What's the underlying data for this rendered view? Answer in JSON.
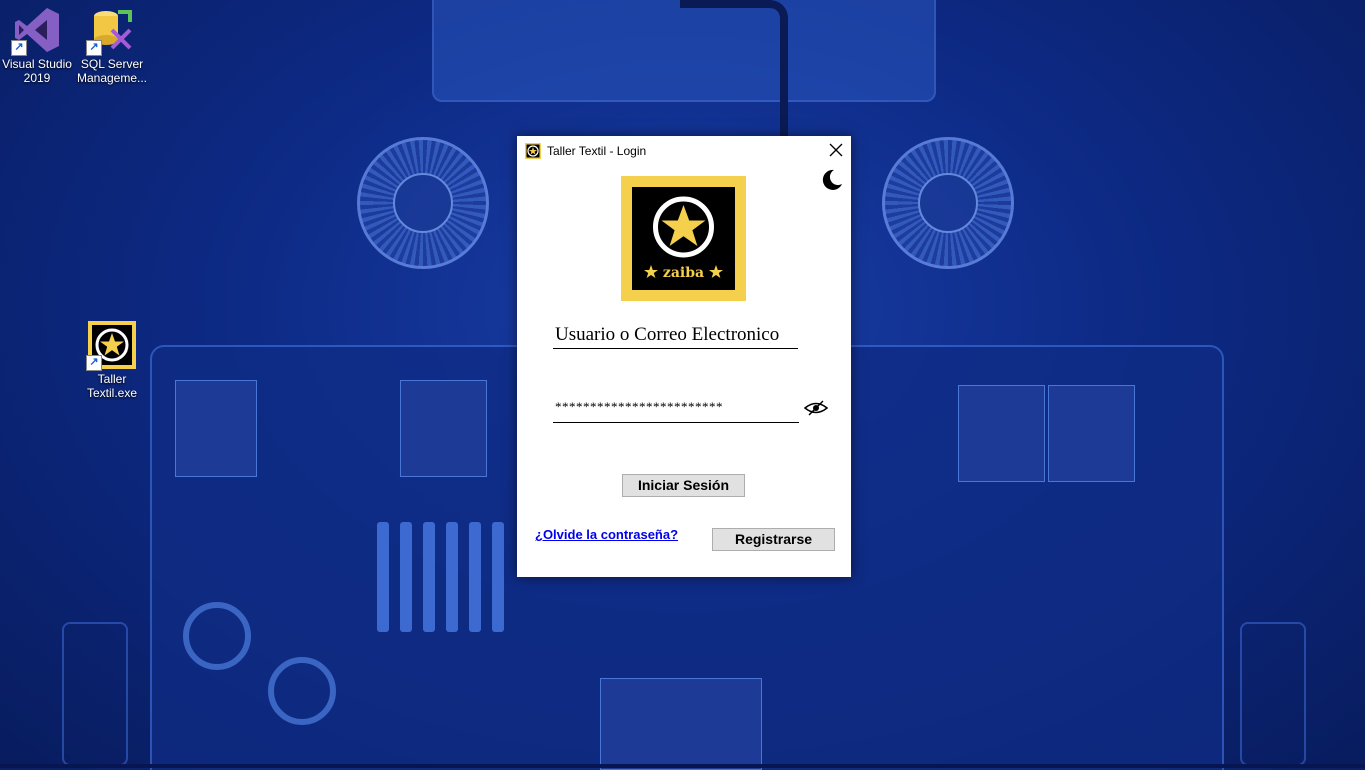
{
  "desktop": {
    "icons": [
      {
        "label_line1": "Visual Studio",
        "label_line2": "2019",
        "icon": "visual-studio-icon",
        "color": "#865fc5"
      },
      {
        "label_line1": "SQL Server",
        "label_line2": "Manageme...",
        "icon": "sql-server-icon",
        "color": "#f2c744"
      },
      {
        "label_line1": "Taller",
        "label_line2": "Textil.exe",
        "icon": "zaiba-star-icon",
        "color": "#f5d04c"
      }
    ]
  },
  "dialog": {
    "title": "Taller Textil - Login",
    "close_icon": "close-icon",
    "theme_toggle_icon": "moon-icon",
    "logo_text": "zaiba",
    "logo_colors": {
      "border": "#f5d04c",
      "background": "#000000",
      "star": "#f5d04c"
    },
    "username_placeholder": "Usuario o Correo Electronico",
    "password_value": "************************",
    "password_toggle_icon": "eye-hidden-icon",
    "login_button": "Iniciar Sesión",
    "forgot_link": "¿Olvide la contraseña?",
    "register_button": "Registrarse"
  }
}
